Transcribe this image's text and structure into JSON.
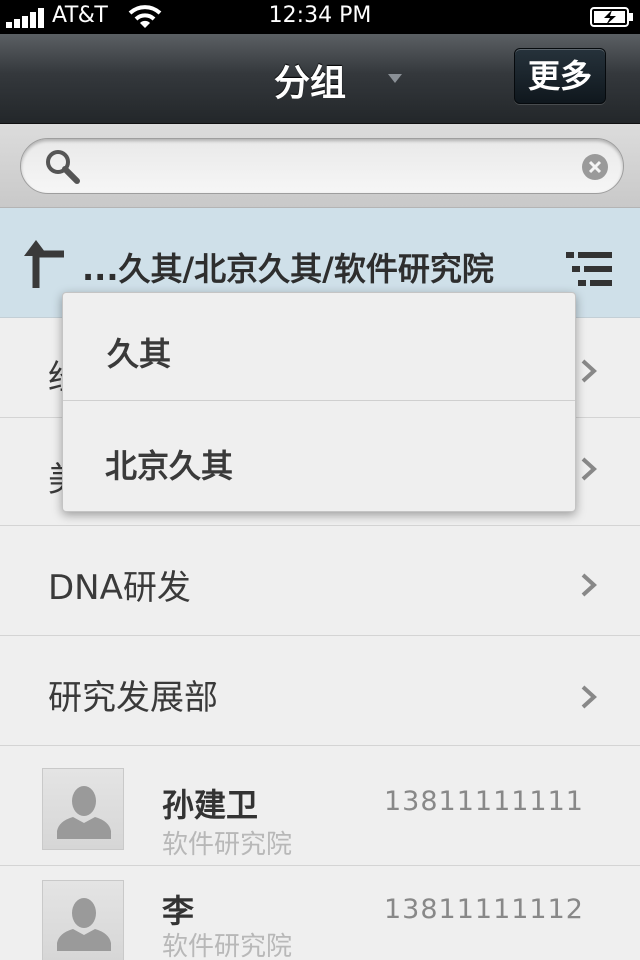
{
  "status_bar": {
    "carrier": "AT&T",
    "time": "12:34 PM",
    "icons": [
      "signal-icon",
      "wifi-icon",
      "battery-charging-icon"
    ]
  },
  "nav_bar": {
    "title": "分组",
    "more_label": "更多",
    "icons": [
      "dropdown-caret-icon"
    ]
  },
  "search": {
    "value": "",
    "placeholder": "",
    "icons": [
      "search-icon",
      "clear-icon"
    ]
  },
  "breadcrumb": {
    "path": "...久其/北京久其/软件研究院",
    "icons": [
      "up-arrow-icon",
      "list-icon"
    ]
  },
  "groups": [
    {
      "label": "经"
    },
    {
      "label": "美"
    },
    {
      "label": "DNA研发"
    },
    {
      "label": "研究发展部"
    }
  ],
  "contacts": [
    {
      "name": "孙建卫",
      "department": "软件研究院",
      "phone": "13811111111"
    },
    {
      "name": "李",
      "department": "软件研究院",
      "phone": "13811111112"
    }
  ],
  "popup_menu": {
    "items": [
      {
        "label": "久其"
      },
      {
        "label": "北京久其"
      }
    ]
  },
  "colors": {
    "nav_bar": "#34383c",
    "breadcrumb_bg": "#cfe0e9",
    "list_bg": "#efefef"
  }
}
